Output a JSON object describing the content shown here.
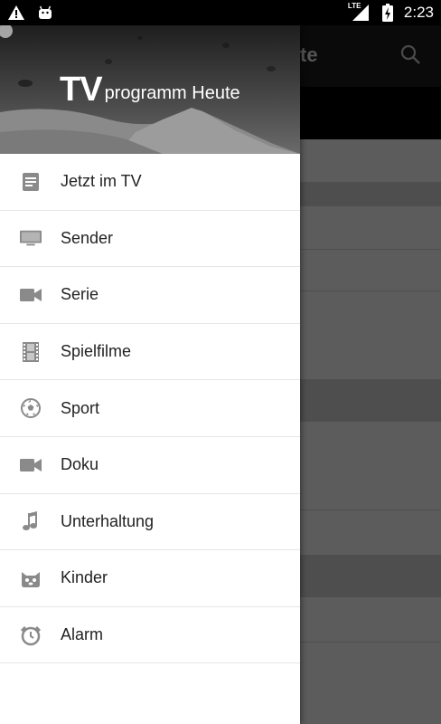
{
  "statusbar": {
    "time": "2:23",
    "network": "LTE",
    "icons": [
      "warning-icon",
      "android-icon",
      "signal-icon",
      "battery-charging-icon"
    ]
  },
  "background_app": {
    "title_fragment": "te",
    "search_icon": "search-icon"
  },
  "drawer": {
    "logo": {
      "tv": "TV",
      "text": "programm Heute",
      "flag_colors": [
        "#000000",
        "#dd0000",
        "#ffcc00"
      ]
    },
    "items": [
      {
        "label": "Jetzt im TV",
        "icon": "document-icon"
      },
      {
        "label": "Sender",
        "icon": "television-icon"
      },
      {
        "label": "Serie",
        "icon": "video-camera-icon"
      },
      {
        "label": "Spielfilme",
        "icon": "film-strip-icon"
      },
      {
        "label": "Sport",
        "icon": "soccer-ball-icon"
      },
      {
        "label": "Doku",
        "icon": "video-camera-icon"
      },
      {
        "label": "Unterhaltung",
        "icon": "music-note-icon"
      },
      {
        "label": "Kinder",
        "icon": "kids-character-icon"
      },
      {
        "label": "Alarm",
        "icon": "alarm-clock-icon"
      }
    ]
  },
  "colors": {
    "icon_gray": "#8a8a8a",
    "label_text": "#222222",
    "divider": "#e6e6e6"
  }
}
